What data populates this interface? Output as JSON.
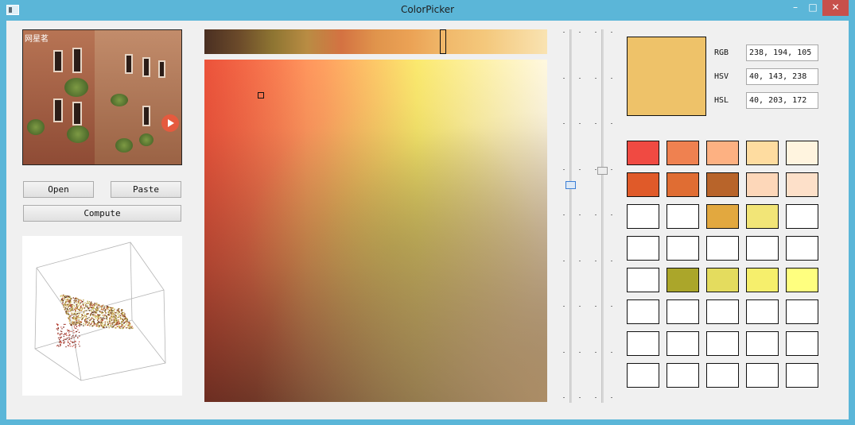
{
  "window": {
    "title": "ColorPicker"
  },
  "controls": {
    "minimize": "–",
    "maximize": "□",
    "close": "✕"
  },
  "preview": {
    "overlay_text": "网星茗"
  },
  "buttons": {
    "open": "Open",
    "paste": "Paste",
    "compute": "Compute"
  },
  "color_values": {
    "rgb_label": "RGB",
    "rgb": "238, 194, 105",
    "hsv_label": "HSV",
    "hsv": "40, 143, 238",
    "hsl_label": "HSL",
    "hsl": "40, 203, 172",
    "current_color": "#eec269"
  },
  "swatches": [
    [
      "#f04a42",
      "#ef8150",
      "#fdb182",
      "#fedca0",
      "#fff4df"
    ],
    [
      "#e05a29",
      "#e06d33",
      "#b8642a",
      "#fdd7b9",
      "#fde0c9"
    ],
    [
      "#ffffff",
      "#ffffff",
      "#e2a83f",
      "#f2e577",
      "#ffffff"
    ],
    [
      "#ffffff",
      "#ffffff",
      "#ffffff",
      "#ffffff",
      "#ffffff"
    ],
    [
      "#ffffff",
      "#aba62a",
      "#e4dc5e",
      "#f6ef6c",
      "#ffff7f"
    ],
    [
      "#ffffff",
      "#ffffff",
      "#ffffff",
      "#ffffff",
      "#ffffff"
    ],
    [
      "#ffffff",
      "#ffffff",
      "#ffffff",
      "#ffffff",
      "#ffffff"
    ],
    [
      "#ffffff",
      "#ffffff",
      "#ffffff",
      "#ffffff",
      "#ffffff"
    ]
  ],
  "hue_selected_fraction": 0.7,
  "sv_cursor_fraction": {
    "s": 0.17,
    "v": 0.1
  }
}
